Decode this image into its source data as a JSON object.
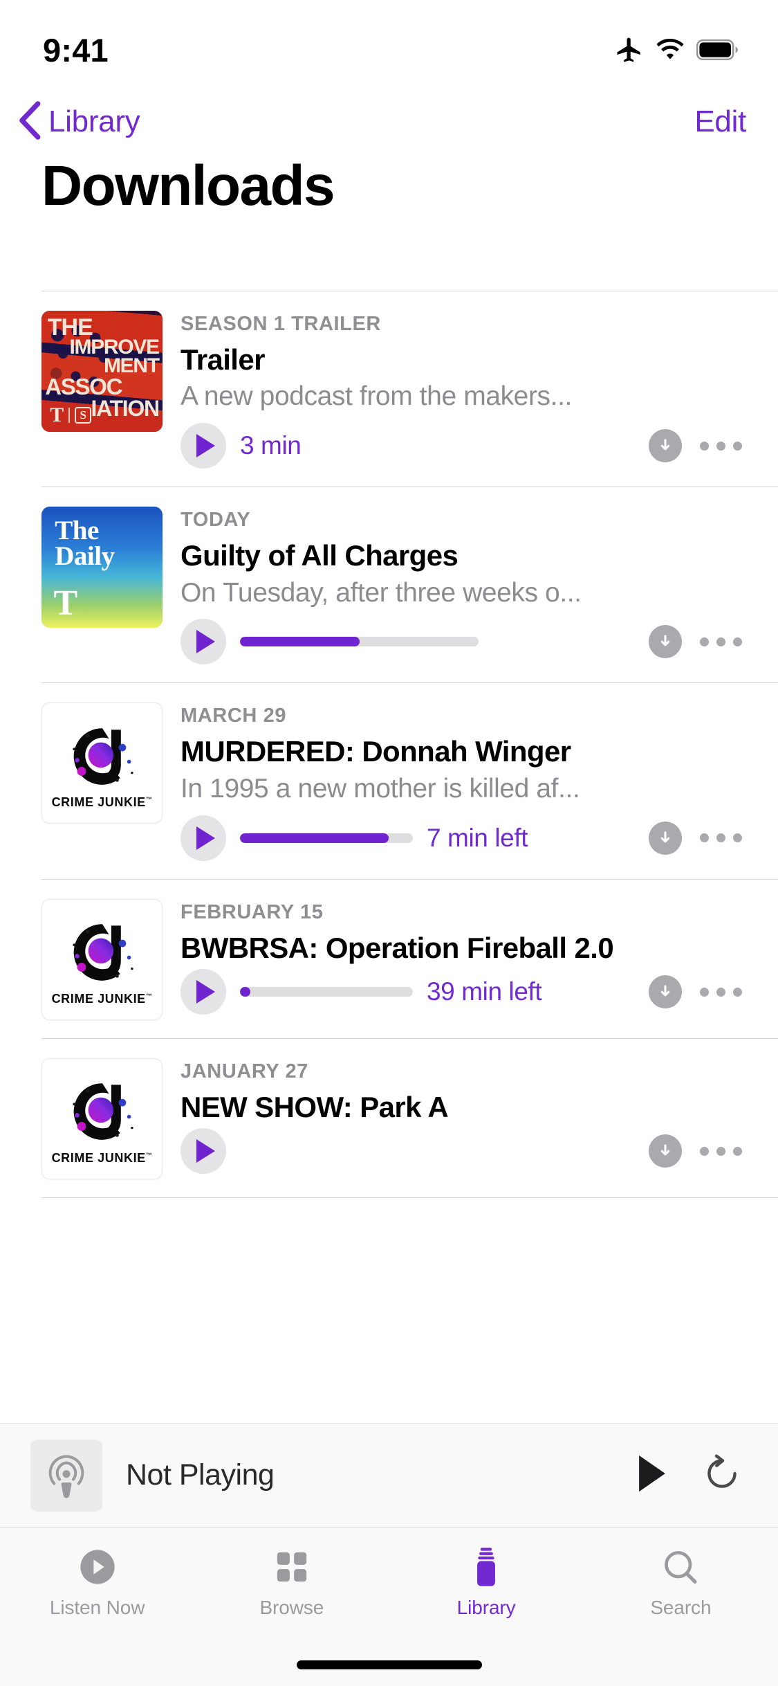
{
  "status_bar": {
    "time": "9:41",
    "icons": [
      "airplane-mode-icon",
      "wifi-icon",
      "battery-icon"
    ]
  },
  "nav_bar": {
    "back_label": "Library",
    "back_icon": "chevron-left-icon",
    "edit_label": "Edit",
    "accent_color": "#7129d0"
  },
  "page_title": "Downloads",
  "episodes": [
    {
      "eyebrow": "SEASON 1 TRAILER",
      "title": "Trailer",
      "description": "A new podcast from the makers...",
      "meta": "3 min",
      "meta_type": "duration",
      "progress_percent": 0,
      "has_progress_bar": false,
      "download_icon": "download-circle-icon",
      "more_icon": "ellipsis-icon",
      "play_icon": "play-icon",
      "artwork": {
        "kind": "improvement-association",
        "line1": "THE",
        "line2": "IMPROVE\nMENT",
        "line3": "ASSOC",
        "line4": "IATION",
        "logo_nyt": "T",
        "logo_serial": "S"
      }
    },
    {
      "eyebrow": "TODAY",
      "title": "Guilty of All Charges",
      "description": "On Tuesday, after three weeks o...",
      "meta": "",
      "meta_type": "none",
      "progress_percent": 50,
      "has_progress_bar": true,
      "download_icon": "download-circle-icon",
      "more_icon": "ellipsis-icon",
      "play_icon": "play-icon",
      "artwork": {
        "kind": "the-daily",
        "line1": "The",
        "line2": "Daily",
        "logo_nyt": "T"
      }
    },
    {
      "eyebrow": "MARCH 29",
      "title": "MURDERED: Donnah Winger",
      "description": "In 1995 a new mother is killed af...",
      "meta": "7 min left",
      "meta_type": "remaining",
      "progress_percent": 86,
      "has_progress_bar": true,
      "download_icon": "download-circle-icon",
      "more_icon": "ellipsis-icon",
      "play_icon": "play-icon",
      "artwork": {
        "kind": "crime-junkie",
        "label": "CRIME JUNKIE",
        "trademark": "™"
      }
    },
    {
      "eyebrow": "FEBRUARY 15",
      "title": "BWBRSA: Operation Fireball 2.0",
      "description": "",
      "meta": "39 min left",
      "meta_type": "remaining",
      "progress_percent": 6,
      "has_progress_bar": true,
      "download_icon": "download-circle-icon",
      "more_icon": "ellipsis-icon",
      "play_icon": "play-icon",
      "artwork": {
        "kind": "crime-junkie",
        "label": "CRIME JUNKIE",
        "trademark": "™"
      }
    },
    {
      "eyebrow": "JANUARY 27",
      "title": "NEW SHOW: Park A",
      "description": "",
      "meta": "",
      "meta_type": "none",
      "progress_percent": 0,
      "has_progress_bar": false,
      "download_icon": "download-circle-icon",
      "more_icon": "ellipsis-icon",
      "play_icon": "play-icon",
      "artwork": {
        "kind": "crime-junkie",
        "label": "CRIME JUNKIE",
        "trademark": "™"
      }
    }
  ],
  "mini_player": {
    "title": "Not Playing",
    "artwork_icon": "podcasts-app-icon",
    "play_icon": "play-icon",
    "skip_icon": "skip-forward-icon"
  },
  "tab_bar": {
    "active_index": 2,
    "tabs": [
      {
        "label": "Listen Now",
        "icon": "play-circle-icon"
      },
      {
        "label": "Browse",
        "icon": "grid-squares-icon"
      },
      {
        "label": "Library",
        "icon": "library-books-icon"
      },
      {
        "label": "Search",
        "icon": "magnifying-glass-icon"
      }
    ]
  },
  "colors": {
    "accent_purple": "#7129d0",
    "progress_fill": "#6f24d0",
    "secondary_text": "#8e8e93",
    "control_gray": "#a9a9ae"
  }
}
